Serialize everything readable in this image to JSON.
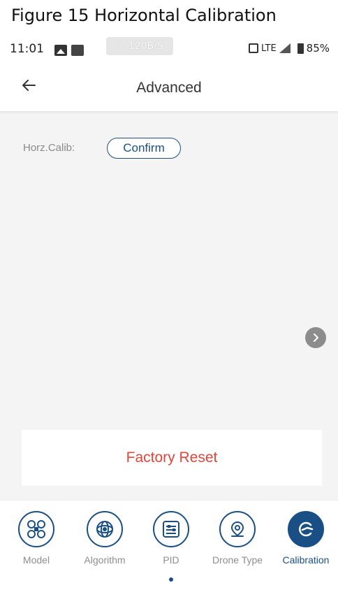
{
  "figure_caption": "Figure 15 Horizontal Calibration",
  "status_bar": {
    "time": "11:01",
    "net_speed": "120B/S",
    "network": "LTE",
    "battery": "85%"
  },
  "header": {
    "title": "Advanced"
  },
  "calibration": {
    "label": "Horz.Calib:",
    "confirm_label": "Confirm"
  },
  "factory_reset_label": "Factory Reset",
  "nav": {
    "items": [
      {
        "label": "Model",
        "icon": "drone-icon",
        "active": false
      },
      {
        "label": "Algorithm",
        "icon": "algorithm-icon",
        "active": false
      },
      {
        "label": "PID",
        "icon": "pid-icon",
        "active": false
      },
      {
        "label": "Drone Type",
        "icon": "location-pin-icon",
        "active": false
      },
      {
        "label": "Calibration",
        "icon": "calibration-icon",
        "active": true
      }
    ]
  },
  "colors": {
    "accent": "#1a4f86",
    "danger": "#e0463b",
    "background": "#f4f4f4"
  }
}
